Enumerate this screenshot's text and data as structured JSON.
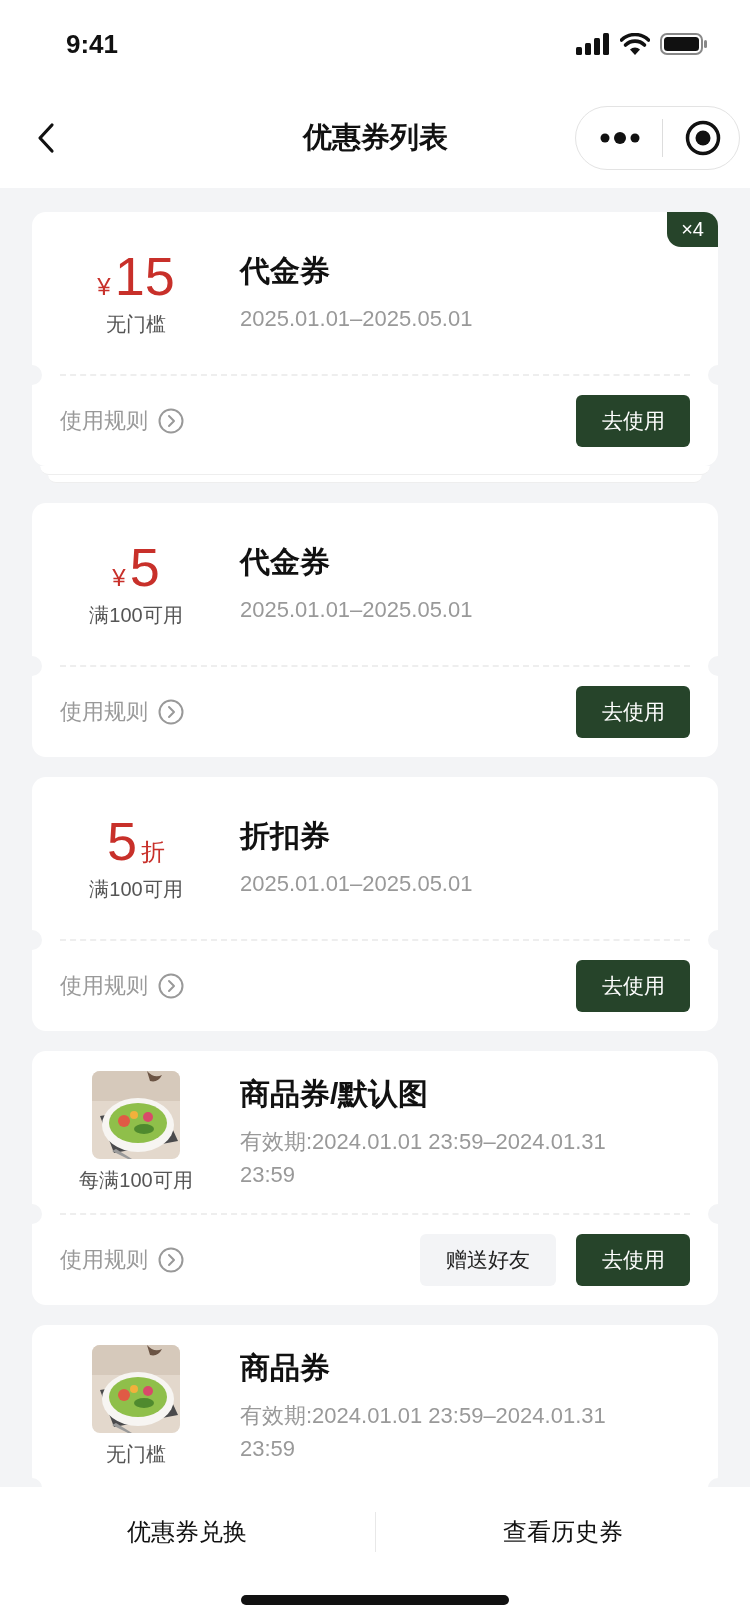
{
  "status_bar": {
    "time": "9:41"
  },
  "nav": {
    "title": "优惠券列表"
  },
  "coupons": [
    {
      "kind": "amount",
      "symbol": "¥",
      "value": "15",
      "condition": "无门槛",
      "title": "代金券",
      "validity": "2025.01.01–2025.05.01",
      "rule_label": "使用规则",
      "use_label": "去使用",
      "badge": "×4",
      "stacked": true
    },
    {
      "kind": "amount",
      "symbol": "¥",
      "value": "5",
      "condition": "满100可用",
      "title": "代金券",
      "validity": "2025.01.01–2025.05.01",
      "rule_label": "使用规则",
      "use_label": "去使用",
      "stacked": false
    },
    {
      "kind": "discount",
      "value": "5",
      "unit": "折",
      "condition": "满100可用",
      "title": "折扣券",
      "validity": "2025.01.01–2025.05.01",
      "rule_label": "使用规则",
      "use_label": "去使用",
      "stacked": false
    },
    {
      "kind": "product",
      "condition": "每满100可用",
      "title": "商品券/默认图",
      "validity": "有效期:2024.01.01 23:59–2024.01.31 23:59",
      "rule_label": "使用规则",
      "gift_label": "赠送好友",
      "use_label": "去使用",
      "stacked": false
    },
    {
      "kind": "product",
      "condition": "无门槛",
      "title": "商品券",
      "validity": "有效期:2024.01.01 23:59–2024.01.31 23:59",
      "stacked": false
    }
  ],
  "bottom_bar": {
    "left": "优惠券兑换",
    "right": "查看历史券"
  }
}
